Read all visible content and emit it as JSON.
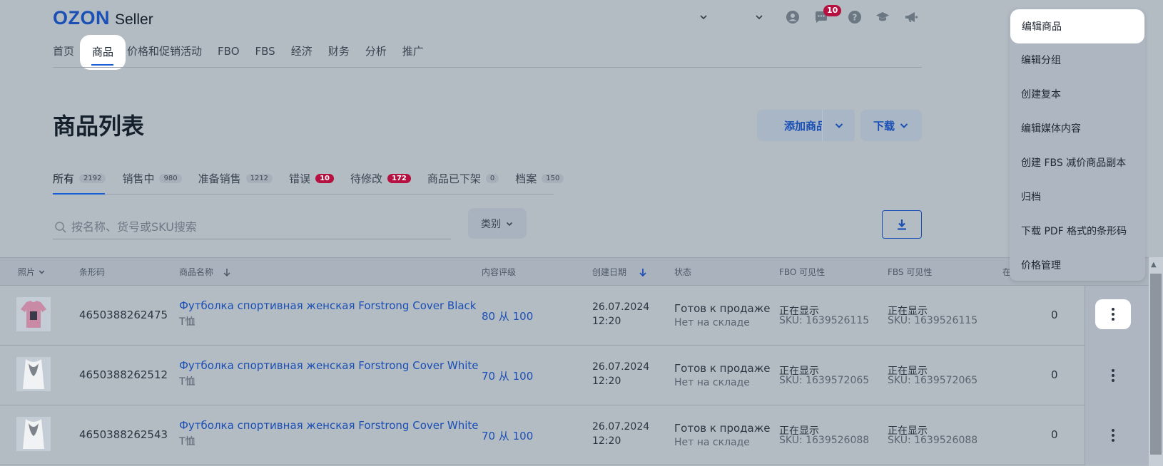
{
  "header": {
    "logo_ozon": "OZON",
    "logo_seller": "Seller",
    "messages_badge": "10"
  },
  "nav": {
    "items": [
      "首页",
      "商品",
      "价格和促销活动",
      "FBO",
      "FBS",
      "经济",
      "财务",
      "分析",
      "推广"
    ],
    "active_index": 1
  },
  "page": {
    "title": "商品列表",
    "add_button": "添加商品",
    "download_button": "下载"
  },
  "tabs": [
    {
      "label": "所有",
      "count": "2192",
      "alert": false
    },
    {
      "label": "销售中",
      "count": "980",
      "alert": false
    },
    {
      "label": "准备销售",
      "count": "1212",
      "alert": false
    },
    {
      "label": "错误",
      "count": "10",
      "alert": true
    },
    {
      "label": "待修改",
      "count": "172",
      "alert": true
    },
    {
      "label": "商品已下架",
      "count": "0",
      "alert": false
    },
    {
      "label": "档案",
      "count": "150",
      "alert": false
    }
  ],
  "search": {
    "placeholder": "按名称、货号或SKU搜索",
    "value": ""
  },
  "filters": {
    "category": "类别"
  },
  "table": {
    "headers": {
      "photo": "照片",
      "barcode": "条形码",
      "name": "商品名称",
      "content_rating": "内容评级",
      "created": "创建日期",
      "status": "状态",
      "fbo": "FBO 可见性",
      "fbs": "FBS 可见性",
      "stock": "在"
    },
    "rows": [
      {
        "barcode": "4650388262475",
        "name": "Футболка спортивная женская Forstrong Cover Black",
        "category": "T恤",
        "rating": "80 从 100",
        "date": "26.07.2024",
        "time": "12:20",
        "status": "Готов к продаже",
        "status_sub": "Нет на складе",
        "fbo": "正在显示",
        "fbo_sku": "SKU: 1639526115",
        "fbs": "正在显示",
        "fbs_sku": "SKU: 1639526115",
        "stock": "0"
      },
      {
        "barcode": "4650388262512",
        "name": "Футболка спортивная женская Forstrong Cover White",
        "category": "T恤",
        "rating": "70 从 100",
        "date": "26.07.2024",
        "time": "12:20",
        "status": "Готов к продаже",
        "status_sub": "Нет на складе",
        "fbo": "正在显示",
        "fbo_sku": "SKU: 1639572065",
        "fbs": "正在显示",
        "fbs_sku": "SKU: 1639572065",
        "stock": "0"
      },
      {
        "barcode": "4650388262543",
        "name": "Футболка спортивная женская Forstrong Cover White",
        "category": "T恤",
        "rating": "70 从 100",
        "date": "26.07.2024",
        "time": "12:20",
        "status": "Готов к продаже",
        "status_sub": "Нет на складе",
        "fbo": "正在显示",
        "fbo_sku": "SKU: 1639526088",
        "fbs": "正在显示",
        "fbs_sku": "SKU: 1639526088",
        "stock": "0"
      }
    ]
  },
  "context_menu": {
    "items": [
      "编辑商品",
      "编辑分组",
      "创建复本",
      "编辑媒体内容",
      "创建 FBS 减价商品副本",
      "归档",
      "下载 PDF 格式的条形码",
      "价格管理"
    ],
    "highlighted_index": 0
  },
  "colors": {
    "accent": "#1a4fb5",
    "alert_badge": "#b5103f",
    "overlay_bg": "#b3bbc3"
  }
}
